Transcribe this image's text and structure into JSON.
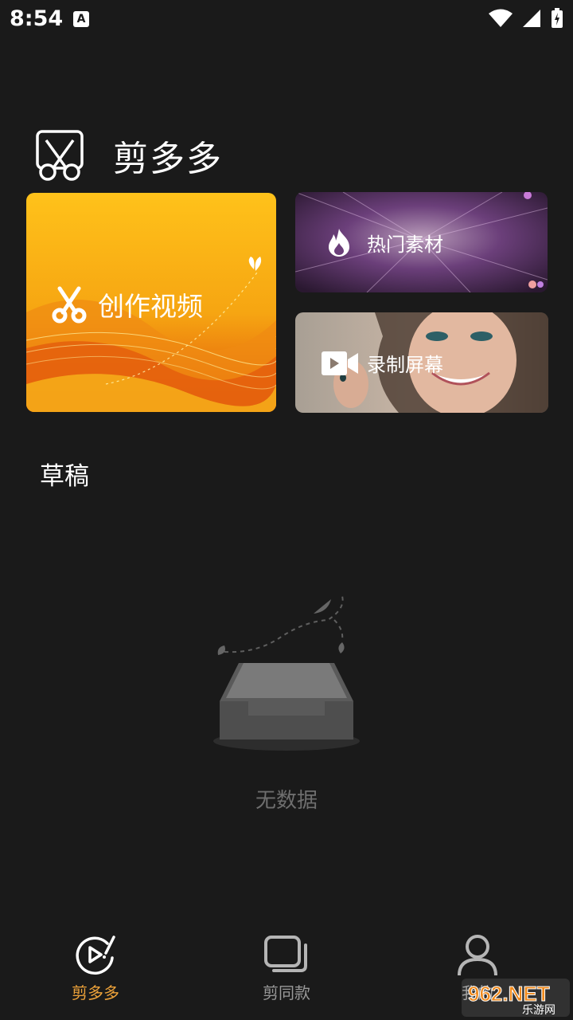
{
  "status_bar": {
    "time": "8:54"
  },
  "header": {
    "app_title": "剪多多"
  },
  "cards": {
    "create": {
      "label": "创作视频"
    },
    "hot": {
      "label": "热门素材"
    },
    "record": {
      "label": "录制屏幕"
    }
  },
  "drafts": {
    "title": "草稿",
    "empty_text": "无数据"
  },
  "tabs": [
    {
      "label": "剪多多",
      "active": true
    },
    {
      "label": "剪同款",
      "active": false
    },
    {
      "label": "我的",
      "active": false
    }
  ],
  "colors": {
    "accent": "#f0a43a",
    "background": "#1a1a1a",
    "card_create_top": "#ffc21a",
    "card_create_bottom": "#e0520a"
  },
  "watermark": {
    "text": "962.NET",
    "subtext": "乐游网"
  }
}
